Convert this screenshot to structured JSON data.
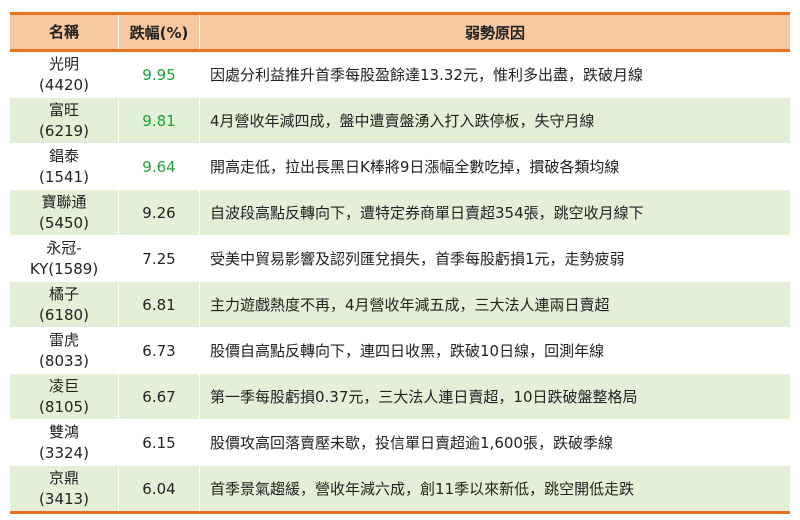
{
  "header": {
    "name": "名稱",
    "pct": "跌幅(%)",
    "reason": "弱勢原因"
  },
  "highlight_color": "#1fa33a",
  "rows": [
    {
      "name": "光明",
      "code": "(4420)",
      "pct": "9.95",
      "highlight": true,
      "reason": "因處分利益推升首季每股盈餘達13.32元，惟利多出盡，跌破月線"
    },
    {
      "name": "富旺",
      "code": "(6219)",
      "pct": "9.81",
      "highlight": true,
      "reason": "4月營收年減四成，盤中遭賣盤湧入打入跌停板，失守月線"
    },
    {
      "name": "錩泰",
      "code": "(1541)",
      "pct": "9.64",
      "highlight": true,
      "reason": "開高走低，拉出長黑日K棒將9日漲幅全數吃掉，摜破各類均線"
    },
    {
      "name": "寶聯通",
      "code": "(5450)",
      "pct": "9.26",
      "highlight": false,
      "reason": "自波段高點反轉向下，遭特定券商單日賣超354張，跳空收月線下"
    },
    {
      "name": "永冠-",
      "code": "KY(1589)",
      "pct": "7.25",
      "highlight": false,
      "reason": "受美中貿易影響及認列匯兌損失，首季每股虧損1元，走勢疲弱"
    },
    {
      "name": "橘子",
      "code": "(6180)",
      "pct": "6.81",
      "highlight": false,
      "reason": "主力遊戲熱度不再，4月營收年減五成，三大法人連兩日賣超"
    },
    {
      "name": "雷虎",
      "code": "(8033)",
      "pct": "6.73",
      "highlight": false,
      "reason": "股價自高點反轉向下，連四日收黑，跌破10日線，回測年線"
    },
    {
      "name": "凌巨",
      "code": "(8105)",
      "pct": "6.67",
      "highlight": false,
      "reason": "第一季每股虧損0.37元，三大法人連日賣超，10日跌破盤整格局"
    },
    {
      "name": "雙鴻",
      "code": "(3324)",
      "pct": "6.15",
      "highlight": false,
      "reason": "股價攻高回落賣壓未歇，投信單日賣超逾1,600張，跌破季線"
    },
    {
      "name": "京鼎",
      "code": "(3413)",
      "pct": "6.04",
      "highlight": false,
      "reason": "首季景氣趨緩，營收年減六成，創11季以來新低，跳空開低走跌"
    }
  ]
}
